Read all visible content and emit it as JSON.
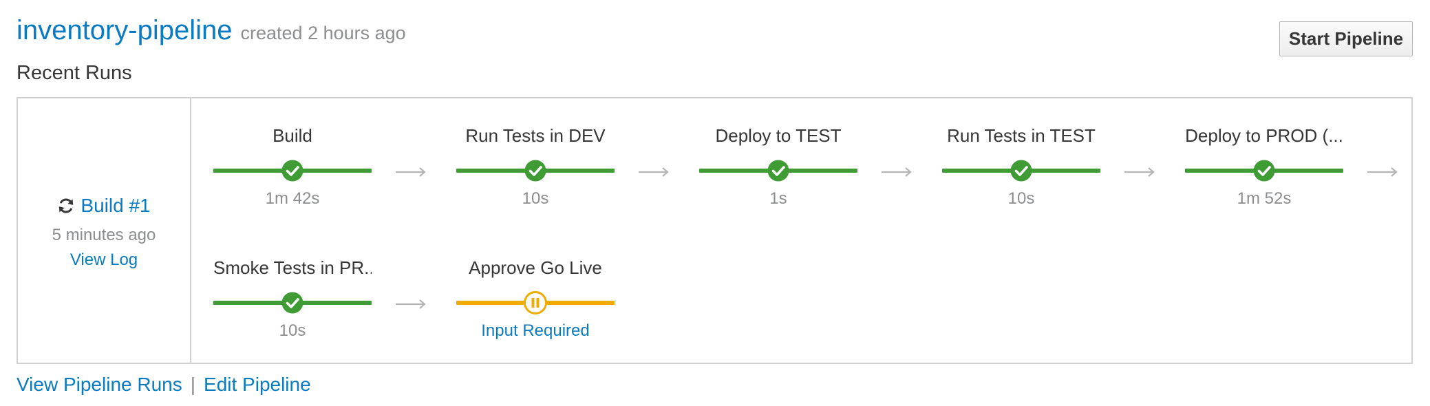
{
  "pipeline": {
    "name": "inventory-pipeline",
    "created": "created 2 hours ago"
  },
  "start_button_label": "Start Pipeline",
  "recent_runs_title": "Recent Runs",
  "build": {
    "label": "Build #1",
    "time": "5 minutes ago",
    "view_log": "View Log",
    "icon": "refresh-icon"
  },
  "stages": [
    {
      "name": "Build",
      "detail": "1m 42s",
      "status": "success"
    },
    {
      "name": "Run Tests in DEV",
      "detail": "10s",
      "status": "success"
    },
    {
      "name": "Deploy to TEST",
      "detail": "1s",
      "status": "success"
    },
    {
      "name": "Run Tests in TEST",
      "detail": "10s",
      "status": "success"
    },
    {
      "name": "Deploy to PROD (...",
      "detail": "1m 52s",
      "status": "success"
    },
    {
      "name": "Smoke Tests in PR...",
      "detail": "10s",
      "status": "success"
    },
    {
      "name": "Approve Go Live",
      "detail": "Input Required",
      "status": "paused"
    }
  ],
  "footer": {
    "view_runs": "View Pipeline Runs",
    "separator": "|",
    "edit": "Edit Pipeline"
  },
  "colors": {
    "link": "#0a7bc2",
    "success": "#3f9c35",
    "paused": "#f0ab00",
    "muted": "#8b8d8f",
    "arrow": "#b5b5b5"
  }
}
